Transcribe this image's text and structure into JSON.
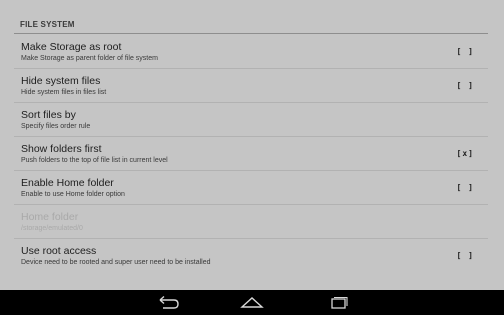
{
  "section": {
    "header": "FILE SYSTEM"
  },
  "prefs": [
    {
      "title": "Make Storage as root",
      "summary": "Make Storage as parent folder of file system",
      "checkbox": "[ ]"
    },
    {
      "title": "Hide system files",
      "summary": "Hide system files in files list",
      "checkbox": "[ ]"
    },
    {
      "title": "Sort files by",
      "summary": "Specify files order rule",
      "checkbox": ""
    },
    {
      "title": "Show folders first",
      "summary": "Push folders to the top of file list in current level",
      "checkbox": "[x]"
    },
    {
      "title": "Enable Home folder",
      "summary": "Enable to use Home folder option",
      "checkbox": "[ ]"
    },
    {
      "title": "Home folder",
      "summary": "/storage/emulated/0",
      "checkbox": ""
    },
    {
      "title": "Use root access",
      "summary": "Device need to be rooted and super user need to be installed",
      "checkbox": "[ ]"
    }
  ],
  "navbar": {
    "back_icon": "back-icon",
    "home_icon": "home-icon",
    "recents_icon": "recents-icon"
  }
}
